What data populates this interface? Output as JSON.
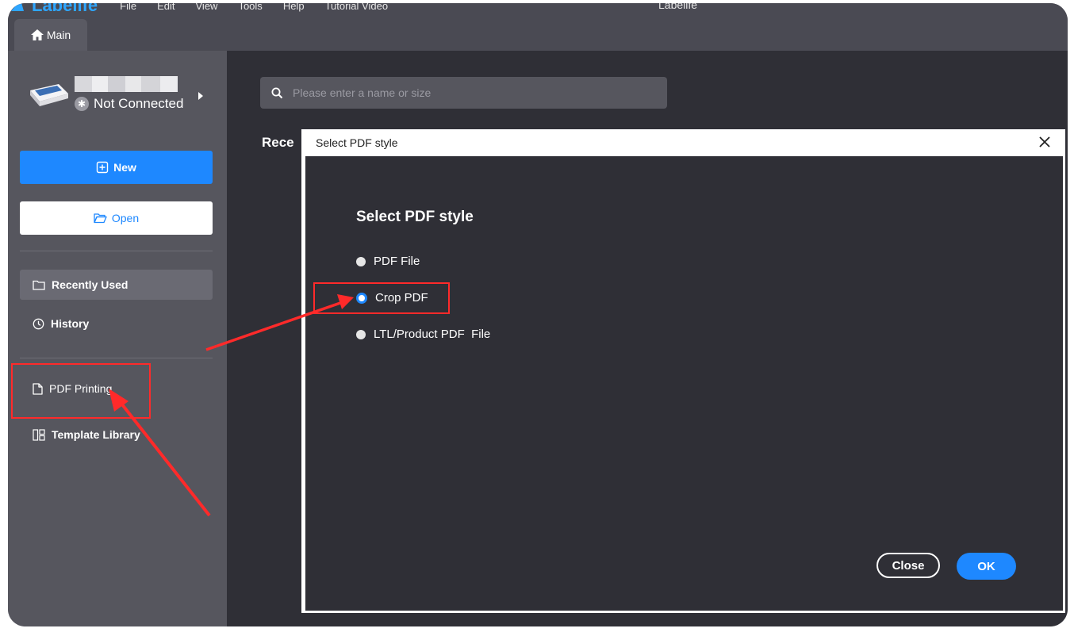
{
  "app": {
    "logo_text": "Labelife",
    "window_title": "Labelife",
    "menu": [
      "File",
      "Edit",
      "View",
      "Tools",
      "Help",
      "Tutorial Video"
    ],
    "main_tab_label": "Main"
  },
  "sidebar": {
    "device_status": "Not Connected",
    "new_label": "New",
    "open_label": "Open",
    "nav": {
      "recently_used": "Recently Used",
      "history": "History",
      "pdf_printing": "PDF Printing",
      "template_library": "Template Library"
    }
  },
  "content": {
    "search_placeholder": "Please enter a name or size",
    "recent_label": "Rece"
  },
  "dialog": {
    "window_title": "Select PDF style",
    "heading": "Select PDF style",
    "options": [
      "PDF File",
      "Crop PDF",
      "LTL/Product PDF  File"
    ],
    "selected": "Crop PDF",
    "close_label": "Close",
    "ok_label": "OK"
  },
  "colors": {
    "accent": "#1e88ff",
    "annotation": "#ff2a2a",
    "sidebar_bg": "#56565e",
    "content_bg": "#2f2f36"
  }
}
